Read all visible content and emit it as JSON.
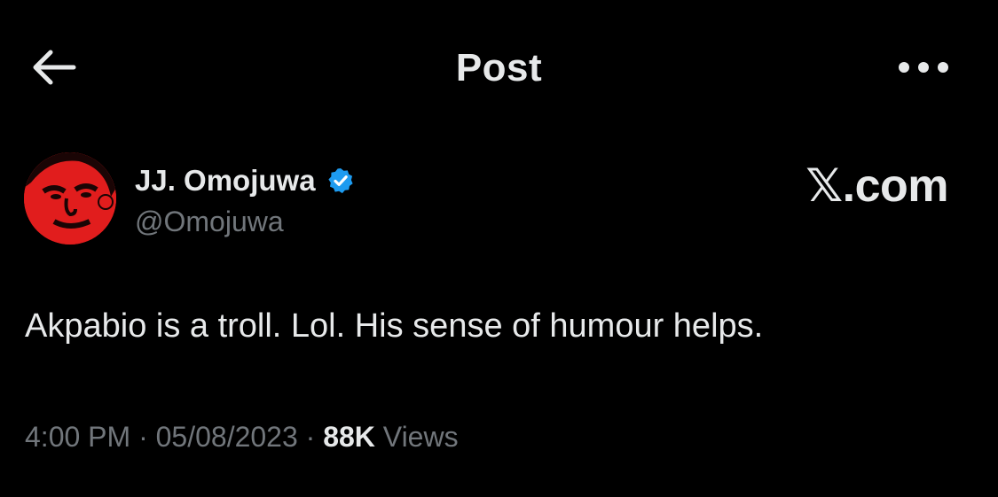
{
  "header": {
    "title": "Post",
    "back_icon": "arrow-left-icon",
    "more_icon": "ellipsis-horizontal-icon"
  },
  "author": {
    "display_name": "JJ. Omojuwa",
    "handle": "@Omojuwa",
    "verified": true,
    "verified_color": "#1d9bf0",
    "avatar_color": "#e11d1d"
  },
  "watermark": {
    "logo": "𝕏",
    "suffix": ".com"
  },
  "post": {
    "text": "Akpabio is a troll. Lol. His sense of humour helps."
  },
  "meta": {
    "time": "4:00 PM",
    "separator": "·",
    "date": "05/08/2023",
    "views_count": "88K",
    "views_label": "Views"
  },
  "colors": {
    "background": "#000000",
    "primary_text": "#e7e9ea",
    "secondary_text": "#71767b",
    "accent": "#1d9bf0"
  }
}
